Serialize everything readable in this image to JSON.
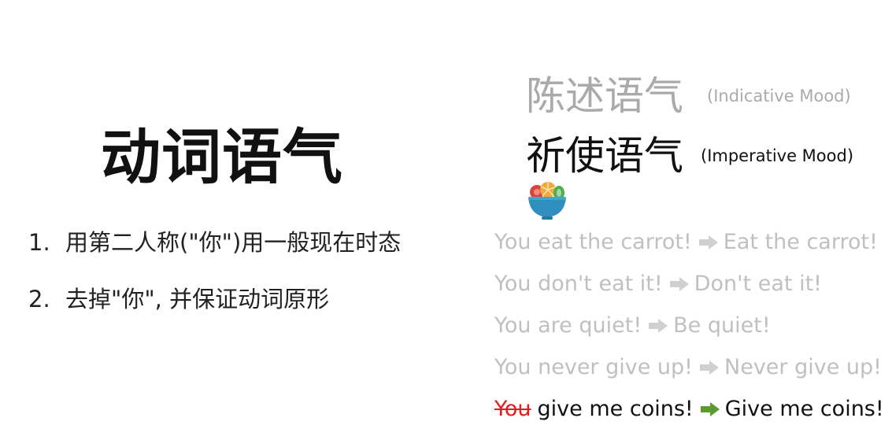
{
  "title": "动词语气",
  "rules": [
    {
      "number": "1.",
      "text": "用第二人称(\"你\")用一般现在时态"
    },
    {
      "number": "2.",
      "text": "去掉\"你\", 并保证动词原形"
    }
  ],
  "moods": {
    "indicative": {
      "zh": "陈述语气",
      "en": "(Indicative Mood)"
    },
    "imperative": {
      "zh": "祈使语气",
      "en": "(Imperative Mood)"
    }
  },
  "examples": [
    {
      "before": "You eat the carrot!",
      "after": "Eat the carrot!",
      "active": false
    },
    {
      "before": "You don't eat it!",
      "after": "Don't eat it!",
      "active": false
    },
    {
      "before": "You are quiet!",
      "after": "Be quiet!",
      "active": false
    },
    {
      "before": "You never give up!",
      "after": "Never give up!",
      "active": false
    },
    {
      "struck": "You",
      "before": "give me coins!",
      "after": "Give me coins!",
      "active": true
    }
  ],
  "icons": {
    "salad": "salad-bowl-icon",
    "arrow": "right-arrow-icon"
  },
  "colors": {
    "inactive_text": "#c0c0c0",
    "active_text": "#111111",
    "strike": "#e02020",
    "arrow_inactive": "#d0d0d0",
    "arrow_active": "#5a9a2e",
    "bowl": "#2f8fbf"
  }
}
